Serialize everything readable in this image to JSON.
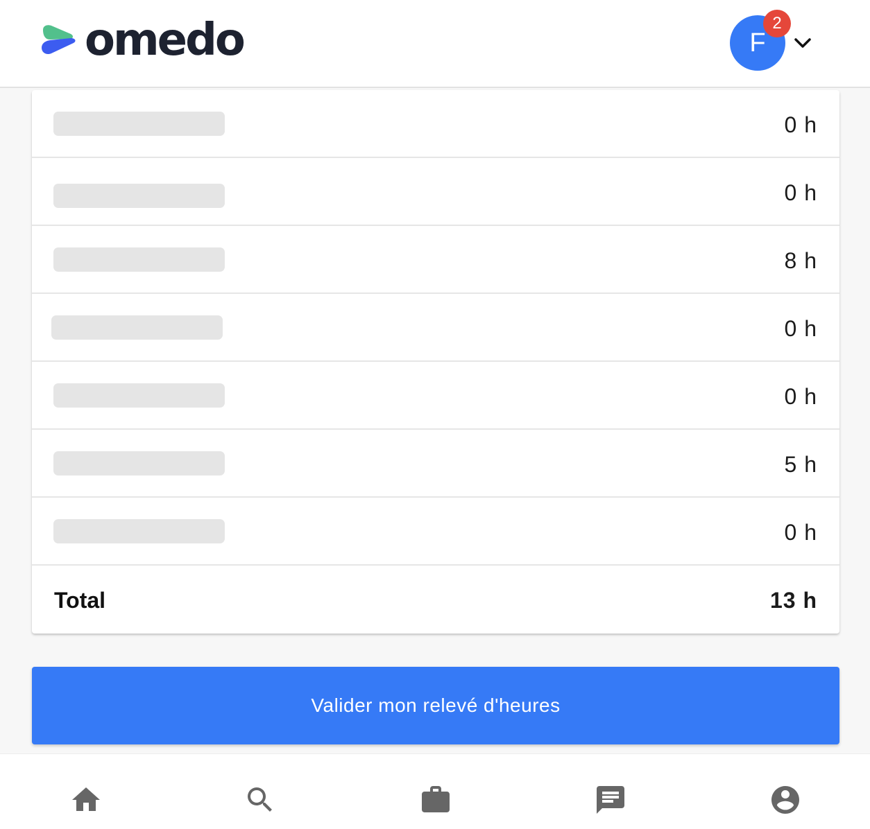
{
  "header": {
    "logo_text": "omedo",
    "avatar_initial": "F",
    "notification_count": "2"
  },
  "timesheet": {
    "rows": [
      {
        "hours": "0 h"
      },
      {
        "hours": "0 h"
      },
      {
        "hours": "8 h"
      },
      {
        "hours": "0 h"
      },
      {
        "hours": "0 h"
      },
      {
        "hours": "5 h"
      },
      {
        "hours": "0 h"
      }
    ],
    "total_label": "Total",
    "total_hours": "13 h"
  },
  "actions": {
    "validate_label": "Valider mon relevé d'heures"
  },
  "bottom_nav": [
    {
      "icon": "home-icon"
    },
    {
      "icon": "search-icon"
    },
    {
      "icon": "briefcase-icon"
    },
    {
      "icon": "chat-icon"
    },
    {
      "icon": "account-icon"
    }
  ],
  "colors": {
    "primary": "#367af6",
    "badge": "#e5473a",
    "logo_dark": "#1d2230",
    "logo_green": "#52c08c",
    "logo_blue": "#3c5cf0"
  }
}
